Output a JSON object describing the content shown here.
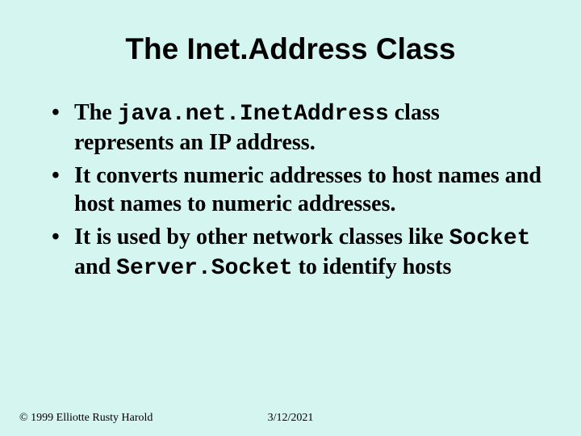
{
  "title": "The Inet.Address Class",
  "bullets": [
    {
      "pre": "The ",
      "code": "java.net.InetAddress",
      "post": " class represents an IP address."
    },
    {
      "pre": "It converts numeric addresses to host names and host names to numeric addresses.",
      "code": "",
      "post": ""
    },
    {
      "pre": "It is used by other network classes like ",
      "code": "Socket",
      "mid": " and ",
      "code2": "Server.Socket",
      "post": " to identify hosts"
    }
  ],
  "footer": {
    "left": "© 1999 Elliotte Rusty Harold",
    "center": "3/12/2021"
  }
}
